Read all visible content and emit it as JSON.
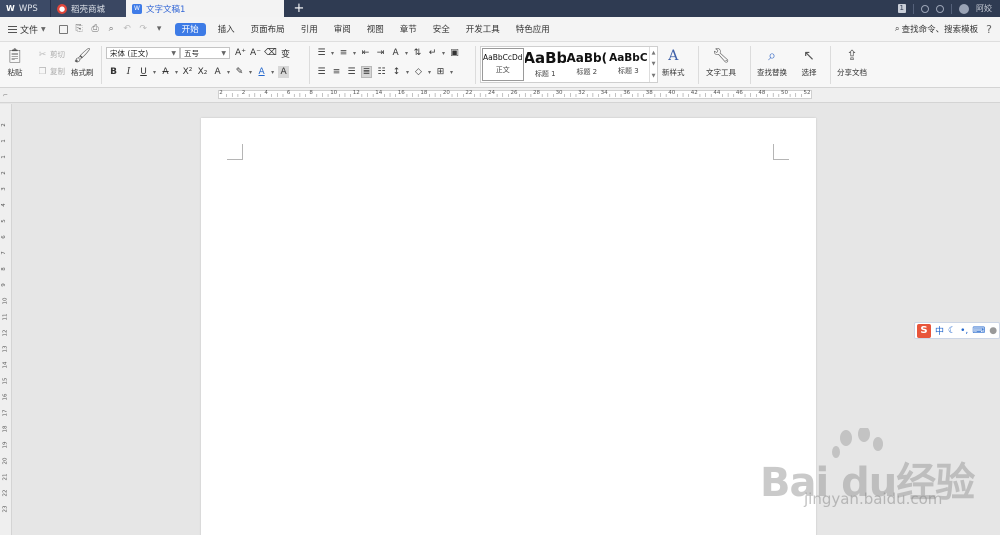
{
  "titlebar": {
    "tabs": [
      {
        "label": "WPS"
      },
      {
        "label": "稻壳商城"
      },
      {
        "label": "文字文稿1"
      }
    ],
    "new_tab": "+",
    "badge": "1",
    "user_label": "阿姣"
  },
  "menubar": {
    "file_label": "文件",
    "items": [
      "开始",
      "插入",
      "页面布局",
      "引用",
      "审阅",
      "视图",
      "章节",
      "安全",
      "开发工具",
      "特色应用"
    ],
    "search_label": "查找命令、搜索模板",
    "help": "?"
  },
  "ribbon": {
    "paste": "粘贴",
    "cut": "剪切",
    "copy": "复制",
    "format_painter": "格式刷",
    "font_name": "宋体 (正文)",
    "font_size": "五号",
    "styles": [
      {
        "preview": "AaBbCcDd",
        "name": "正文"
      },
      {
        "preview": "AaBb",
        "name": "标题 1"
      },
      {
        "preview": "AaBb(",
        "name": "标题 2"
      },
      {
        "preview": "AaBbC",
        "name": "标题 3"
      }
    ],
    "new_style": "新样式",
    "text_tools": "文字工具",
    "find_replace": "查找替换",
    "select": "选择",
    "share": "分享文档"
  },
  "ruler": {
    "labels": [
      "2",
      "2",
      "4",
      "6",
      "8",
      "10",
      "12",
      "14",
      "16",
      "18",
      "20",
      "22",
      "24",
      "26",
      "28",
      "30",
      "32",
      "34",
      "36",
      "38",
      "40",
      "42",
      "44",
      "46",
      "48",
      "50",
      "52"
    ],
    "vlabels": [
      "2",
      "1",
      "1",
      "2",
      "3",
      "4",
      "5",
      "6",
      "7",
      "8",
      "9",
      "10",
      "11",
      "12",
      "13",
      "14",
      "15",
      "16",
      "17",
      "18",
      "19",
      "20",
      "21",
      "22",
      "23"
    ]
  },
  "ime": {
    "lang": "中"
  },
  "watermark": {
    "brand": "Bai du经验",
    "url": "jingyan.baidu.com"
  }
}
